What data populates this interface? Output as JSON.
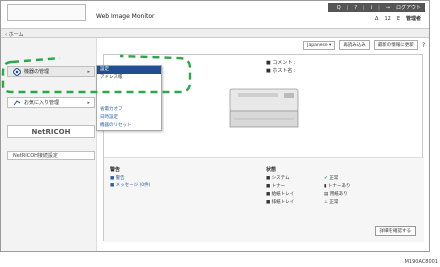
{
  "header": {
    "app_title": "Web Image Monitor",
    "top_links": [
      "Q",
      "?",
      "i",
      "→",
      "ログアウト"
    ],
    "status_items": [
      "Δ",
      "12",
      "E",
      "管理者"
    ],
    "home": "ホーム"
  },
  "sidebar": {
    "device_mgmt": "機器の管理",
    "favorites": "お気に入り管理",
    "netricoh": "NetRICOH",
    "netricoh_link": "NetRICOH接続設定"
  },
  "dropdown": {
    "items": [
      "設定",
      "アドレス帳",
      "",
      "",
      "",
      "省電力オフ",
      "日時設定",
      "機器のリセット"
    ]
  },
  "main": {
    "language": "Japanese",
    "refresh": "再読み込み",
    "auto_refresh": "最新の情報に更新",
    "info": [
      "■ コメント  :",
      "■ ホスト名  :"
    ]
  },
  "status_section": {
    "left_title": "警告",
    "left_items": [
      "■ 警告",
      "■ メッセージ (0件)"
    ],
    "right_title": "状態",
    "right_items": [
      {
        "label": "■ システム",
        "value": "正常"
      },
      {
        "label": "■ トナー",
        "value": "トナーあり"
      },
      {
        "label": "■ 給紙トレイ",
        "value": "用紙あり"
      },
      {
        "label": "■ 排紙トレイ",
        "value": "正常"
      }
    ],
    "confirm": "詳細を確認する"
  },
  "footer_code": "M190AC8001",
  "colors": {
    "accent": "#1f4f8f",
    "highlight": "#2aa84a",
    "link": "#2a5ca8"
  }
}
